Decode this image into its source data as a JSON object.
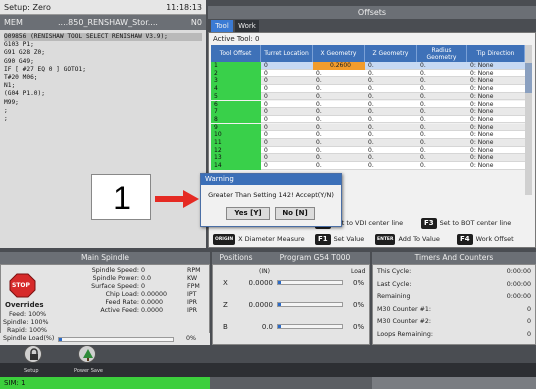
{
  "setup": {
    "label": "Setup: Zero",
    "time": "11:18:13"
  },
  "program": {
    "mode": "MEM",
    "name": "....850_RENSHAW_Stor....",
    "flag": "N0",
    "lines": [
      "O09856 (RENISHAW TOOL SELECT RENISHAW V3.9);",
      "G103 P1;",
      "G91 G28 Z0;",
      "G90 G49;",
      "IF [ #27 EQ 0 ] GOTO1;",
      "T#20 M06;",
      "N1;",
      "(G04 P1.0);",
      "M99;",
      ";",
      ";"
    ]
  },
  "offsets": {
    "title": "Offsets",
    "tabs": [
      "Tool",
      "Work"
    ],
    "active_tool": "Active Tool: 0",
    "columns": [
      "Tool Offset",
      "Turret Location",
      "X Geometry",
      "Z Geometry",
      "Radius Geometry",
      "Tip Direction"
    ],
    "rows": [
      [
        "1",
        "0",
        "0.2600",
        "0.",
        "0.",
        "0: None"
      ],
      [
        "2",
        "0",
        "0.",
        "0.",
        "0.",
        "0: None"
      ],
      [
        "3",
        "0",
        "0.",
        "0.",
        "0.",
        "0: None"
      ],
      [
        "4",
        "0",
        "0.",
        "0.",
        "0.",
        "0: None"
      ],
      [
        "5",
        "0",
        "0.",
        "0.",
        "0.",
        "0: None"
      ],
      [
        "6",
        "0",
        "0.",
        "0.",
        "0.",
        "0: None"
      ],
      [
        "7",
        "0",
        "0.",
        "0.",
        "0.",
        "0: None"
      ],
      [
        "8",
        "0",
        "0.",
        "0.",
        "0.",
        "0: None"
      ],
      [
        "9",
        "0",
        "0.",
        "0.",
        "0.",
        "0: None"
      ],
      [
        "10",
        "0",
        "0.",
        "0.",
        "0.",
        "0: None"
      ],
      [
        "11",
        "0",
        "0.",
        "0.",
        "0.",
        "0: None"
      ],
      [
        "12",
        "0",
        "0.",
        "0.",
        "0.",
        "0: None"
      ],
      [
        "13",
        "0",
        "0.",
        "0.",
        "0.",
        "0: None"
      ],
      [
        "14",
        "0",
        "0.",
        "0.",
        "0.",
        "0: None"
      ]
    ],
    "fkeys": {
      "enter_label": "Enter A Value",
      "f2": "F2",
      "f2_text": "Set to VDI center line",
      "f3": "F3",
      "f3_text": "Set to BOT center line",
      "x_dia_key": "ORIGIN",
      "x_dia_text": "X Diameter Measure",
      "f1": "F1",
      "f1_text": "Set Value",
      "enter": "ENTER",
      "enter_text": "Add To Value",
      "f4": "F4",
      "f4_text": "Work Offset"
    }
  },
  "warning": {
    "title": "Warning",
    "message": "Greater Than Setting 142! Accept(Y/N)",
    "yes": "Yes [Y]",
    "no": "No [N]"
  },
  "callout": {
    "number": "1"
  },
  "spindle": {
    "title": "Main Spindle",
    "stop": "STOP",
    "overrides_label": "Overrides",
    "feed": "Feed:  100%",
    "spindle": "Spindle:  100%",
    "rapid": "Rapid:  100%",
    "params": [
      {
        "k": "Spindle Speed:",
        "v": "0",
        "u": "RPM"
      },
      {
        "k": "Spindle Power:",
        "v": "0.0",
        "u": "KW"
      },
      {
        "k": "Surface Speed:",
        "v": "0",
        "u": "FPM"
      },
      {
        "k": "Chip Load:",
        "v": "0.00000",
        "u": "IPT"
      },
      {
        "k": "Feed Rate:",
        "v": "0.0000",
        "u": "IPR"
      },
      {
        "k": "Active Feed:",
        "v": "0.0000",
        "u": "IPR"
      }
    ],
    "load_label": "Spindle Load(%)",
    "load_value": "0%",
    "load_fraction": 0.0
  },
  "positions": {
    "title": "Positions",
    "program_label": "Program G54 T000",
    "unit": "(IN)",
    "load_header": "Load",
    "axes": [
      {
        "name": "X",
        "value": "0.0000",
        "load": "0%"
      },
      {
        "name": "Z",
        "value": "0.0000",
        "load": "0%"
      },
      {
        "name": "B",
        "value": "0.0",
        "load": "0%"
      }
    ]
  },
  "timers": {
    "title": "Timers And Counters",
    "items": [
      {
        "k": "This Cycle:",
        "v": "0:00:00"
      },
      {
        "k": "Last Cycle:",
        "v": "0:00:00"
      },
      {
        "k": "Remaining",
        "v": "0:00:00"
      },
      {
        "k": "M30 Counter #1:",
        "v": "0"
      },
      {
        "k": "M30 Counter #2:",
        "v": "0"
      },
      {
        "k": "Loops Remaining:",
        "v": "0"
      }
    ]
  },
  "bottom": {
    "setup_label": "Setup",
    "power_label": "Power Save",
    "sim": "SIM: 1"
  },
  "colors": {
    "accent": "#3b7bd4",
    "green": "#39d04a",
    "highlight": "#f29c2c",
    "stop_red": "#d62a2a"
  }
}
